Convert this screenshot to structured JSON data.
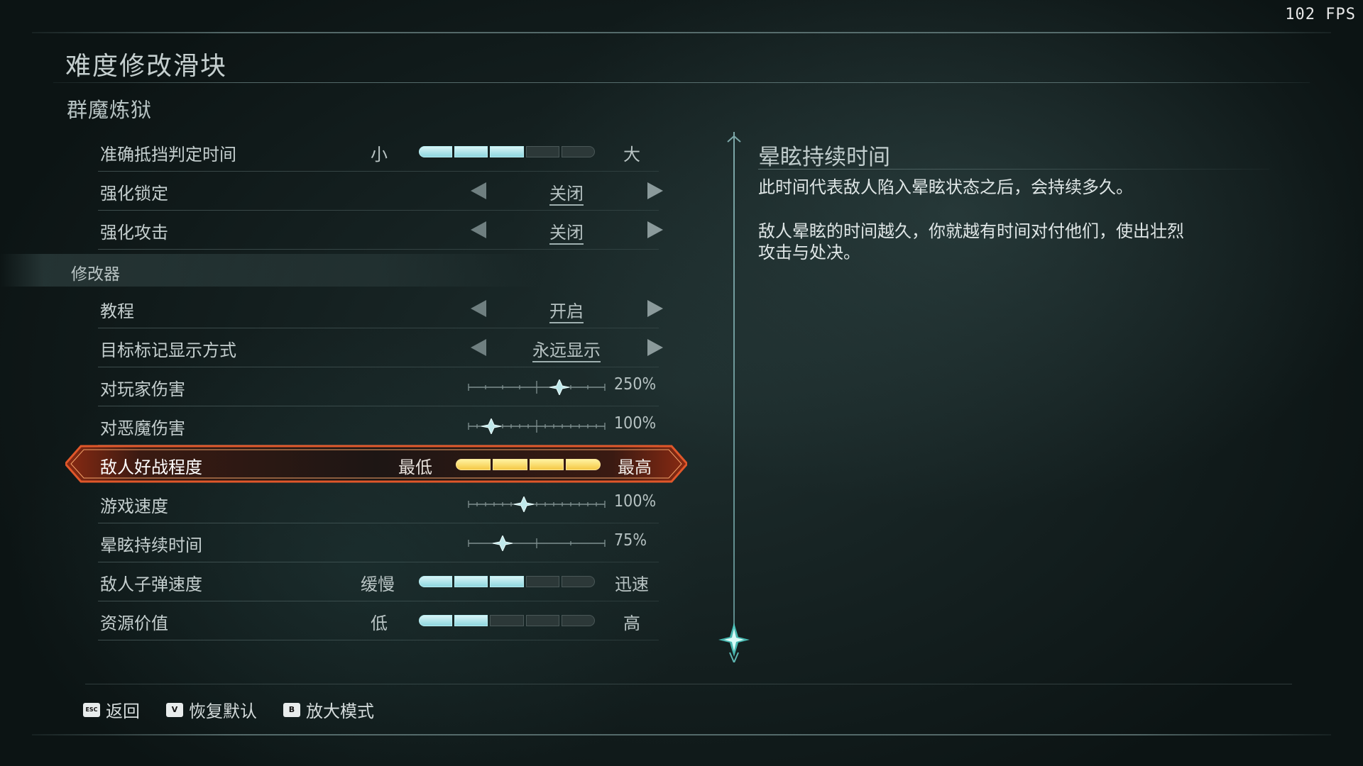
{
  "fps": "102 FPS",
  "page_title": "难度修改滑块",
  "section_title": "群魔炼狱",
  "group_header": "修改器",
  "rows_top": [
    {
      "label": "准确抵挡判定时间",
      "type": "segments",
      "lo": "小",
      "hi": "大",
      "filled": 3,
      "total": 5
    },
    {
      "label": "强化锁定",
      "type": "selector",
      "value": "关闭"
    },
    {
      "label": "强化攻击",
      "type": "selector",
      "value": "关闭"
    }
  ],
  "rows_mod": [
    {
      "label": "教程",
      "type": "selector",
      "value": "开启"
    },
    {
      "label": "目标标记显示方式",
      "type": "selector",
      "value": "永远显示"
    },
    {
      "label": "对玩家伤害",
      "type": "slider",
      "value": "250%"
    },
    {
      "label": "对恶魔伤害",
      "type": "slider",
      "value": "100%"
    },
    {
      "label": "敌人好战程度",
      "type": "segments",
      "lo": "最低",
      "hi": "最高",
      "filled": 5,
      "total": 5,
      "active": true
    },
    {
      "label": "游戏速度",
      "type": "slider",
      "value": "100%"
    },
    {
      "label": "晕眩持续时间",
      "type": "slider",
      "value": "75%"
    },
    {
      "label": "敌人子弹速度",
      "type": "segments",
      "lo": "缓慢",
      "hi": "迅速",
      "filled": 3,
      "total": 5
    },
    {
      "label": "资源价值",
      "type": "segments",
      "lo": "低",
      "hi": "高",
      "filled": 2,
      "total": 5
    }
  ],
  "detail": {
    "title": "晕眩持续时间",
    "p1": "此时间代表敌人陷入晕眩状态之后，会持续多久。",
    "p2": "敌人晕眩的时间越久，你就越有时间对付他们，使出壮烈攻击与处决。"
  },
  "footer": [
    {
      "key": "ESC",
      "label": "返回"
    },
    {
      "key": "V",
      "label": "恢复默认"
    },
    {
      "key": "B",
      "label": "放大模式"
    }
  ],
  "colors": {
    "segment_on": "#a9e4ea",
    "segment_active": "#f5c845",
    "highlight": "#c0461f"
  }
}
